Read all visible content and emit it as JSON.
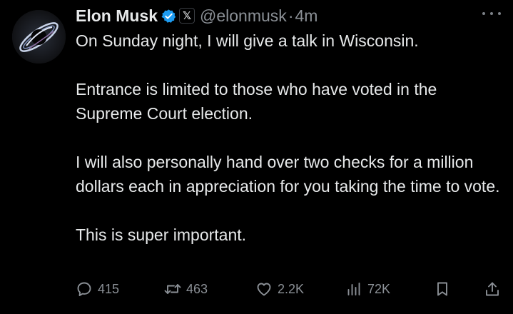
{
  "author": {
    "display_name": "Elon Musk",
    "verified_icon": "verified-badge-icon",
    "affiliate_icon": "x-logo-icon",
    "x_badge_glyph": "𝕏",
    "handle": "@elonmusk",
    "separator": "·",
    "time_ago": "4m"
  },
  "post": {
    "paragraphs": [
      "On Sunday night, I will give a talk in Wisconsin.",
      "Entrance is limited to those who have voted in the Supreme Court election.",
      "I will also personally hand over two checks for a million dollars each in appreciation for you taking the time to vote.",
      "This is super important."
    ]
  },
  "actions": {
    "replies": "415",
    "reposts": "463",
    "likes": "2.2K",
    "views": "72K"
  },
  "colors": {
    "background": "#000000",
    "text": "#e7e9ea",
    "secondary_text": "#8b9096",
    "verified_blue": "#1d9bf0"
  }
}
